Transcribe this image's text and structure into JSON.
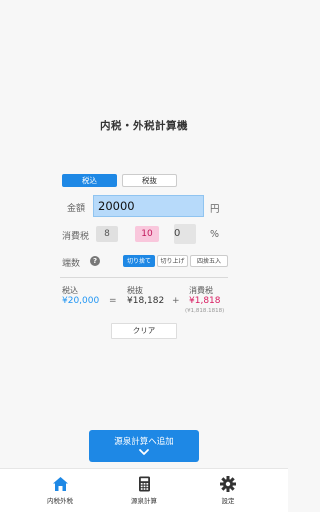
{
  "title": "内税・外税計算機",
  "tabs": {
    "active": "税込",
    "inactive": "税抜"
  },
  "amount": {
    "label": "金額",
    "value": "20000",
    "unit": "円"
  },
  "tax": {
    "label": "消費税",
    "rate8": "8",
    "rate10": "10",
    "custom": "0",
    "unit": "%"
  },
  "rounding": {
    "label": "端数",
    "help": "?",
    "options": [
      "切り捨て",
      "切り上げ",
      "四捨五入"
    ],
    "selected": "切り捨て"
  },
  "result": {
    "incl_label": "税込",
    "incl_value": "¥20,000",
    "eq": "=",
    "excl_label": "税抜",
    "excl_value": "¥18,182",
    "plus": "+",
    "tax_label": "消費税",
    "tax_value": "¥1,818",
    "tax_exact": "(¥1,818.1818)"
  },
  "clear_label": "クリア",
  "add_button": {
    "label": "源泉計算へ追加",
    "icon": "chevron-down-icon"
  },
  "tabbar": [
    {
      "label": "内税外税",
      "icon": "home-icon",
      "active": true
    },
    {
      "label": "源泉計算",
      "icon": "calculator-icon",
      "active": false
    },
    {
      "label": "設定",
      "icon": "gear-icon",
      "active": false
    }
  ],
  "colors": {
    "accent": "#1e88e5",
    "incl": "#2196f3",
    "tax": "#d81b60",
    "pink_bg": "#f9c7dc",
    "input_bg": "#b7dafa"
  }
}
